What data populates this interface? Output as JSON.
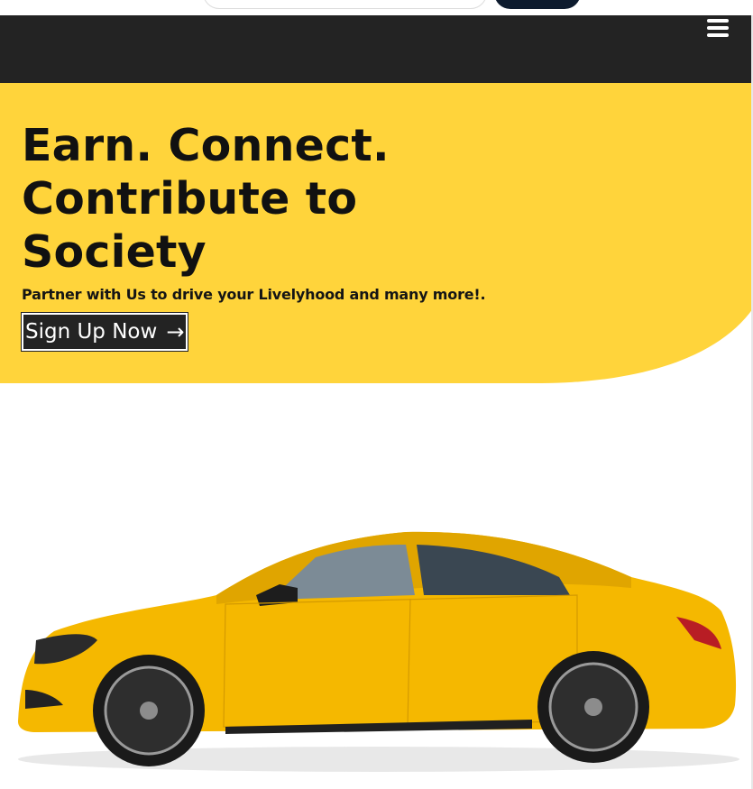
{
  "header": {
    "menu_icon": "hamburger-menu-icon"
  },
  "hero": {
    "headline": "Earn. Connect. Contribute to Society",
    "tagline": "Partner with Us to drive your Livelyhood and many more!.",
    "signup_label": "Sign Up Now",
    "signup_arrow": "→",
    "background_color": "#ffd43b"
  },
  "colors": {
    "navbar": "#232323",
    "accent_yellow": "#ffd43b",
    "car_yellow": "#f5b800"
  },
  "car_image": {
    "icon": "yellow-sedan-car-image"
  }
}
